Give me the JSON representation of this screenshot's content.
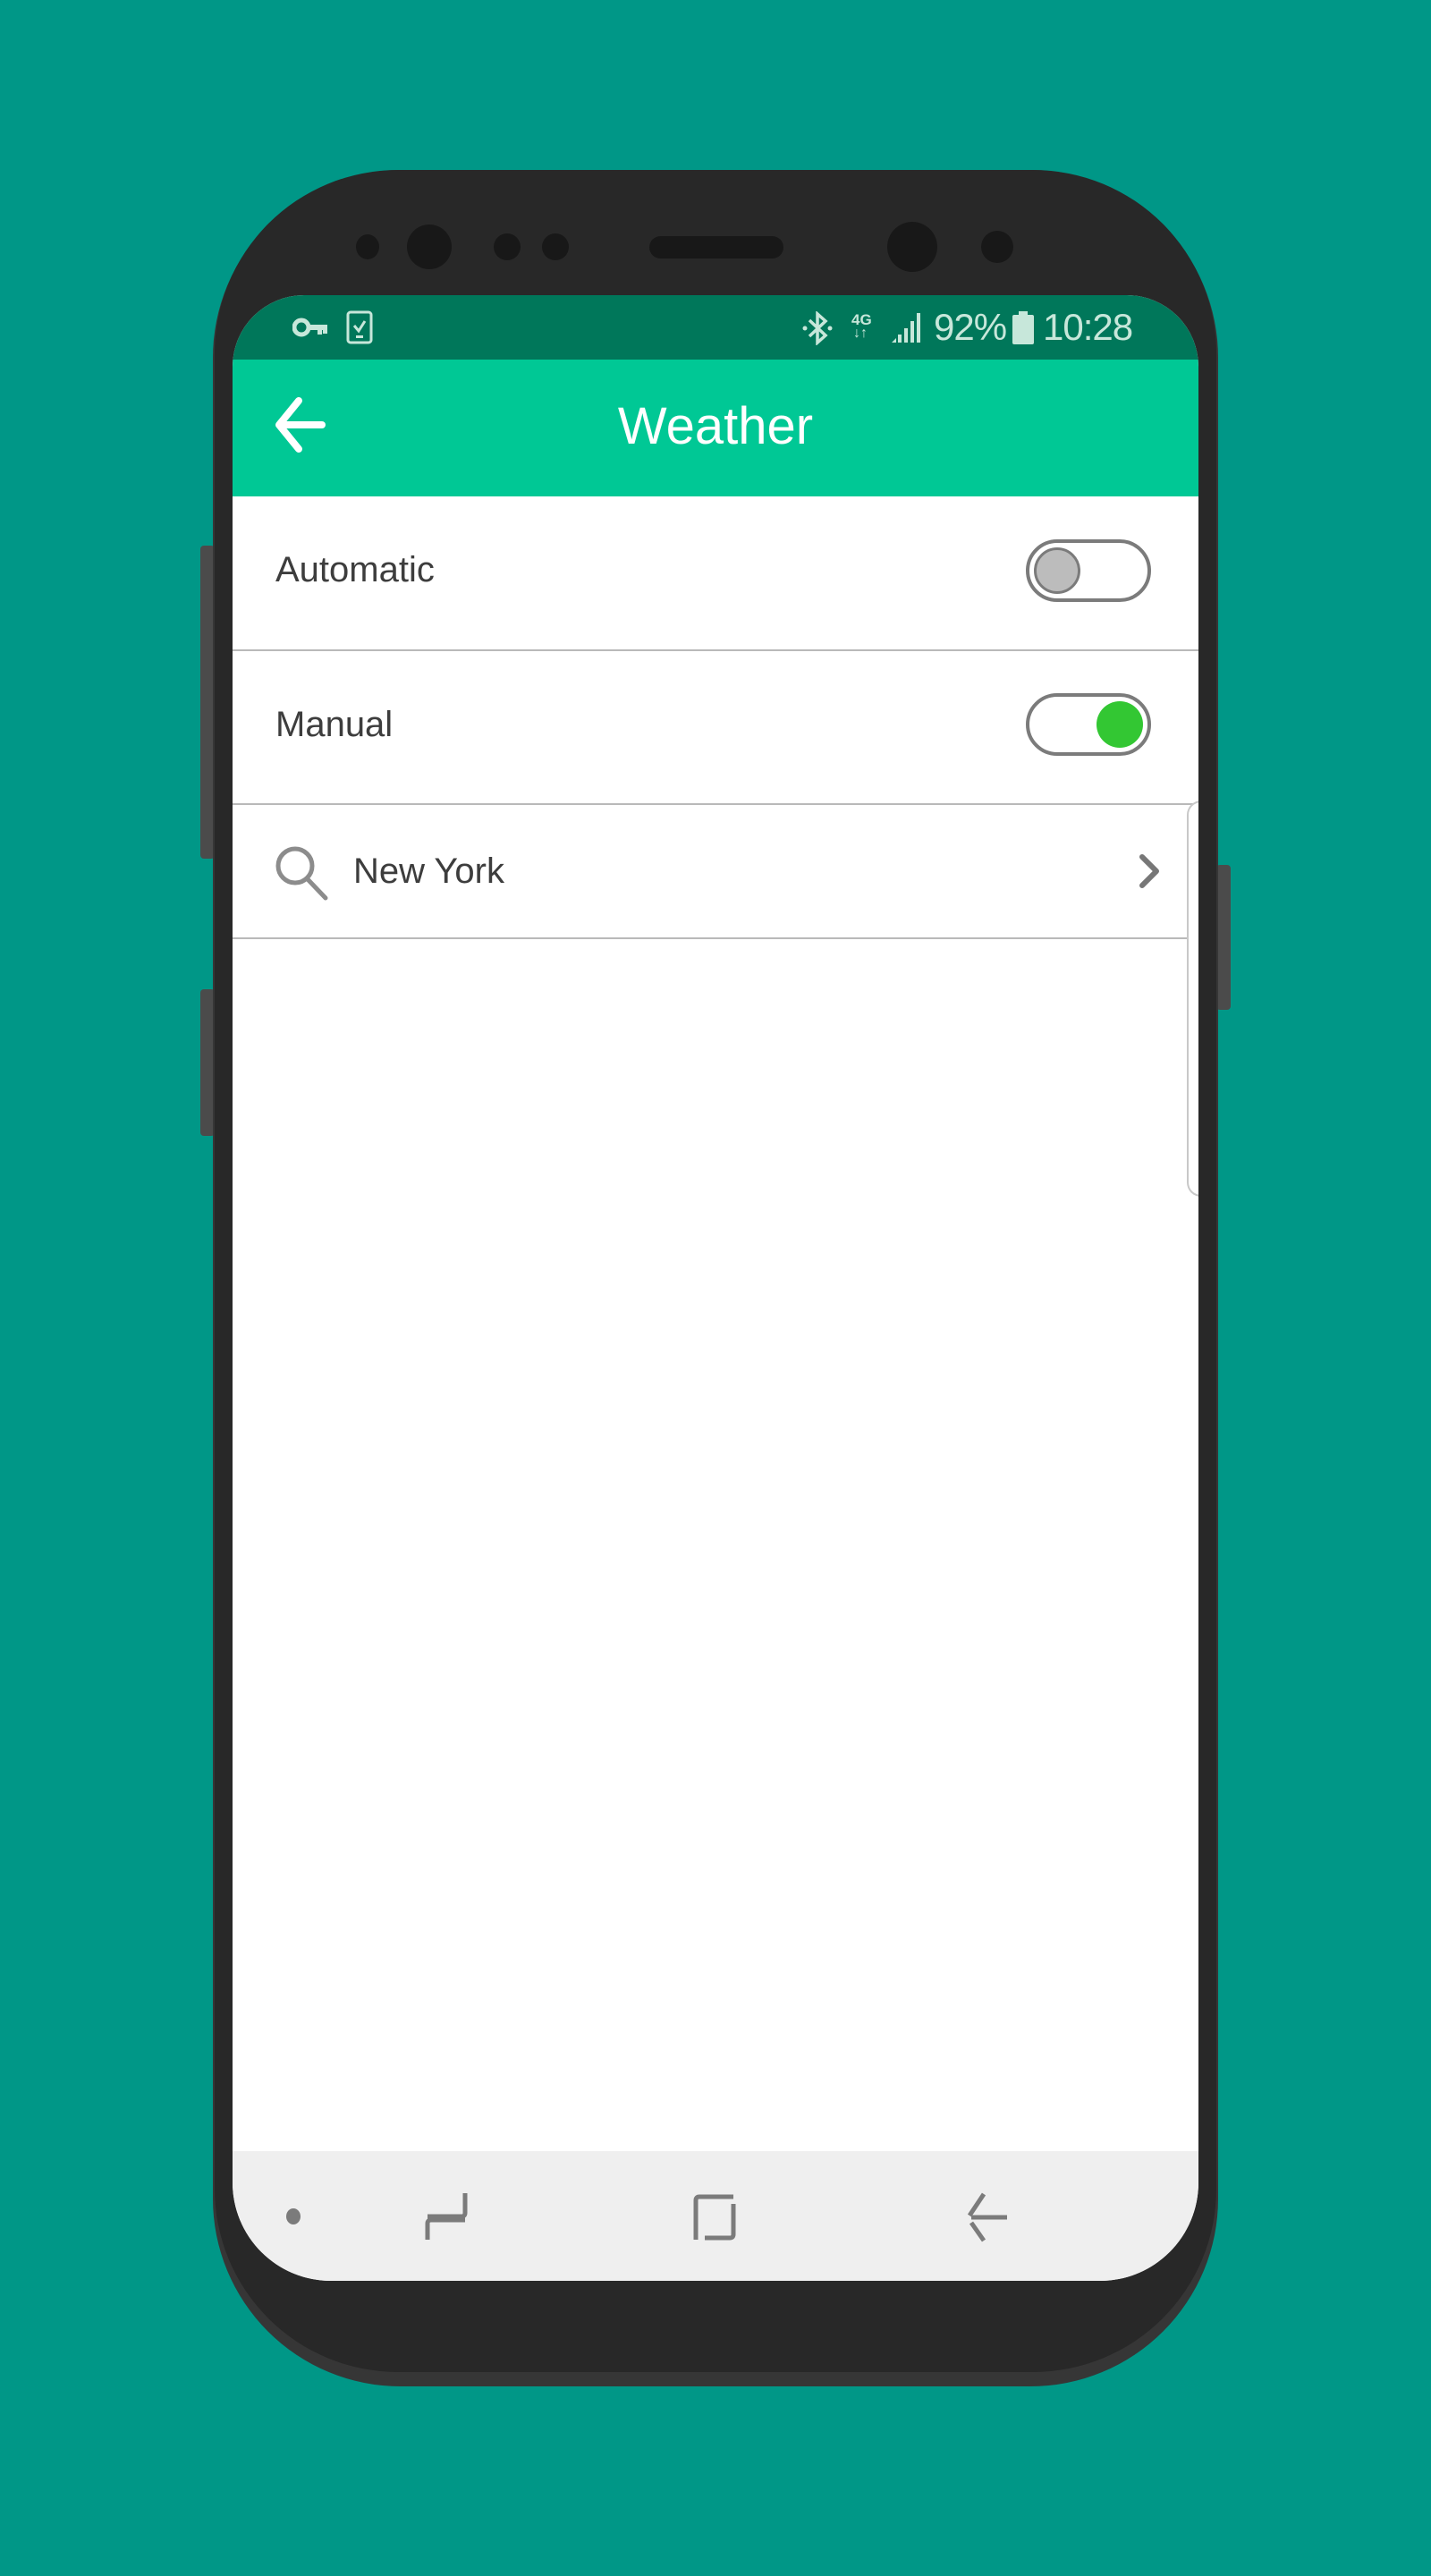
{
  "status_bar": {
    "left_icons": [
      "vpn-key-icon",
      "device-check-icon"
    ],
    "right_icons": [
      "bluetooth-icon",
      "network-4g-icon",
      "signal-icon",
      "battery-icon"
    ],
    "network_type": "4G",
    "battery_percent": "92%",
    "time": "10:28"
  },
  "app_bar": {
    "title": "Weather",
    "back_icon": "arrow-left-icon"
  },
  "settings": {
    "automatic": {
      "label": "Automatic",
      "enabled": false
    },
    "manual": {
      "label": "Manual",
      "enabled": true
    },
    "location": {
      "value": "New York",
      "icon": "search-icon",
      "trailing_icon": "chevron-right-icon"
    }
  },
  "colors": {
    "background": "#009787",
    "status_bar": "#00775a",
    "app_bar": "#00c895",
    "toggle_on": "#33c733",
    "toggle_off": "#bcbcbc"
  },
  "nav_bar": {
    "items": [
      "dot-indicator",
      "recent-apps-icon",
      "home-icon",
      "back-icon"
    ]
  }
}
